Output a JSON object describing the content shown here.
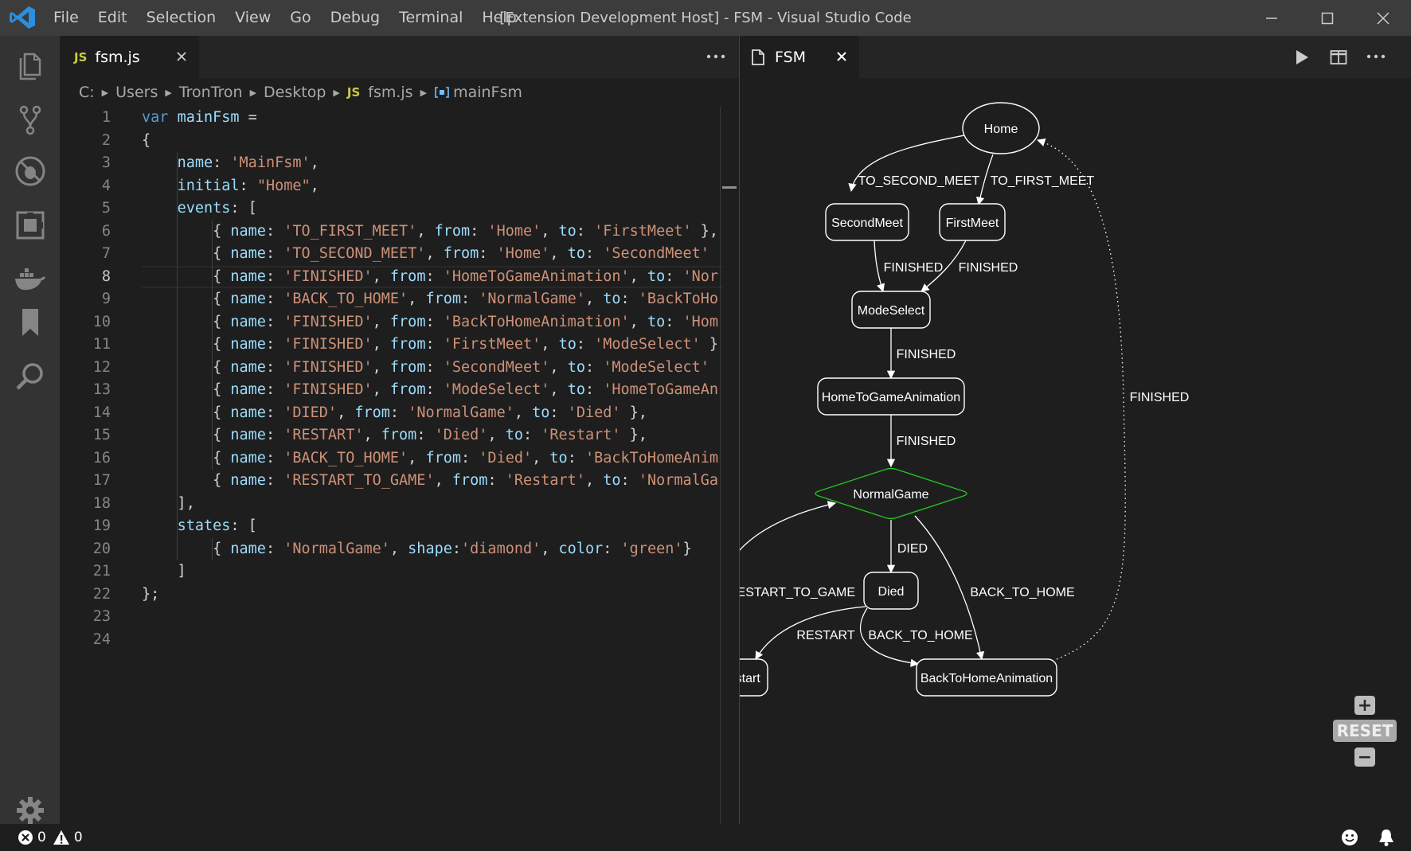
{
  "titlebar": {
    "menu": [
      "File",
      "Edit",
      "Selection",
      "View",
      "Go",
      "Debug",
      "Terminal",
      "Help"
    ],
    "title": "[Extension Development Host] - FSM - Visual Studio Code"
  },
  "activitybar": {
    "icons": [
      "explorer-icon",
      "source-control-icon",
      "debug-icon",
      "extensions-icon",
      "docker-icon",
      "bookmark-icon",
      "search-icon"
    ],
    "bottom_icon": "gear-icon"
  },
  "editor_left": {
    "tab": {
      "badge": "JS",
      "label": "fsm.js"
    },
    "breadcrumb": [
      "C:",
      "Users",
      "TronTron",
      "Desktop",
      "fsm.js",
      "mainFsm"
    ],
    "active_line": 8,
    "lines": [
      [
        [
          "kw",
          "var "
        ],
        [
          "var",
          "mainFsm "
        ],
        [
          "pun",
          "="
        ]
      ],
      [
        [
          "pun",
          "{"
        ]
      ],
      [
        [
          "pun",
          "    "
        ],
        [
          "var",
          "name"
        ],
        [
          "pun",
          ": "
        ],
        [
          "str",
          "'MainFsm'"
        ],
        [
          "pun",
          ","
        ]
      ],
      [
        [
          "pun",
          "    "
        ],
        [
          "var",
          "initial"
        ],
        [
          "pun",
          ": "
        ],
        [
          "str",
          "\"Home\""
        ],
        [
          "pun",
          ","
        ]
      ],
      [
        [
          "pun",
          "    "
        ],
        [
          "var",
          "events"
        ],
        [
          "pun",
          ": ["
        ]
      ],
      [
        [
          "pun",
          "        { "
        ],
        [
          "var",
          "name"
        ],
        [
          "pun",
          ": "
        ],
        [
          "str",
          "'TO_FIRST_MEET'"
        ],
        [
          "pun",
          ", "
        ],
        [
          "var",
          "from"
        ],
        [
          "pun",
          ": "
        ],
        [
          "str",
          "'Home'"
        ],
        [
          "pun",
          ", "
        ],
        [
          "var",
          "to"
        ],
        [
          "pun",
          ": "
        ],
        [
          "str",
          "'FirstMeet'"
        ],
        [
          "pun",
          " },"
        ]
      ],
      [
        [
          "pun",
          "        { "
        ],
        [
          "var",
          "name"
        ],
        [
          "pun",
          ": "
        ],
        [
          "str",
          "'TO_SECOND_MEET'"
        ],
        [
          "pun",
          ", "
        ],
        [
          "var",
          "from"
        ],
        [
          "pun",
          ": "
        ],
        [
          "str",
          "'Home'"
        ],
        [
          "pun",
          ", "
        ],
        [
          "var",
          "to"
        ],
        [
          "pun",
          ": "
        ],
        [
          "str",
          "'SecondMeet'"
        ]
      ],
      [
        [
          "pun",
          "        { "
        ],
        [
          "var",
          "name"
        ],
        [
          "pun",
          ": "
        ],
        [
          "str",
          "'FINISHED'"
        ],
        [
          "pun",
          ", "
        ],
        [
          "var",
          "from"
        ],
        [
          "pun",
          ": "
        ],
        [
          "str",
          "'HomeToGameAnimation'"
        ],
        [
          "pun",
          ", "
        ],
        [
          "var",
          "to"
        ],
        [
          "pun",
          ": "
        ],
        [
          "str",
          "'Nor"
        ]
      ],
      [
        [
          "pun",
          "        { "
        ],
        [
          "var",
          "name"
        ],
        [
          "pun",
          ": "
        ],
        [
          "str",
          "'BACK_TO_HOME'"
        ],
        [
          "pun",
          ", "
        ],
        [
          "var",
          "from"
        ],
        [
          "pun",
          ": "
        ],
        [
          "str",
          "'NormalGame'"
        ],
        [
          "pun",
          ", "
        ],
        [
          "var",
          "to"
        ],
        [
          "pun",
          ": "
        ],
        [
          "str",
          "'BackToHo"
        ]
      ],
      [
        [
          "pun",
          "        { "
        ],
        [
          "var",
          "name"
        ],
        [
          "pun",
          ": "
        ],
        [
          "str",
          "'FINISHED'"
        ],
        [
          "pun",
          ", "
        ],
        [
          "var",
          "from"
        ],
        [
          "pun",
          ": "
        ],
        [
          "str",
          "'BackToHomeAnimation'"
        ],
        [
          "pun",
          ", "
        ],
        [
          "var",
          "to"
        ],
        [
          "pun",
          ": "
        ],
        [
          "str",
          "'Hom"
        ]
      ],
      [
        [
          "pun",
          "        { "
        ],
        [
          "var",
          "name"
        ],
        [
          "pun",
          ": "
        ],
        [
          "str",
          "'FINISHED'"
        ],
        [
          "pun",
          ", "
        ],
        [
          "var",
          "from"
        ],
        [
          "pun",
          ": "
        ],
        [
          "str",
          "'FirstMeet'"
        ],
        [
          "pun",
          ", "
        ],
        [
          "var",
          "to"
        ],
        [
          "pun",
          ": "
        ],
        [
          "str",
          "'ModeSelect'"
        ],
        [
          "pun",
          " }"
        ]
      ],
      [
        [
          "pun",
          "        { "
        ],
        [
          "var",
          "name"
        ],
        [
          "pun",
          ": "
        ],
        [
          "str",
          "'FINISHED'"
        ],
        [
          "pun",
          ", "
        ],
        [
          "var",
          "from"
        ],
        [
          "pun",
          ": "
        ],
        [
          "str",
          "'SecondMeet'"
        ],
        [
          "pun",
          ", "
        ],
        [
          "var",
          "to"
        ],
        [
          "pun",
          ": "
        ],
        [
          "str",
          "'ModeSelect'"
        ]
      ],
      [
        [
          "pun",
          "        { "
        ],
        [
          "var",
          "name"
        ],
        [
          "pun",
          ": "
        ],
        [
          "str",
          "'FINISHED'"
        ],
        [
          "pun",
          ", "
        ],
        [
          "var",
          "from"
        ],
        [
          "pun",
          ": "
        ],
        [
          "str",
          "'ModeSelect'"
        ],
        [
          "pun",
          ", "
        ],
        [
          "var",
          "to"
        ],
        [
          "pun",
          ": "
        ],
        [
          "str",
          "'HomeToGameAn"
        ]
      ],
      [
        [
          "pun",
          "        { "
        ],
        [
          "var",
          "name"
        ],
        [
          "pun",
          ": "
        ],
        [
          "str",
          "'DIED'"
        ],
        [
          "pun",
          ", "
        ],
        [
          "var",
          "from"
        ],
        [
          "pun",
          ": "
        ],
        [
          "str",
          "'NormalGame'"
        ],
        [
          "pun",
          ", "
        ],
        [
          "var",
          "to"
        ],
        [
          "pun",
          ": "
        ],
        [
          "str",
          "'Died'"
        ],
        [
          "pun",
          " },"
        ]
      ],
      [
        [
          "pun",
          "        { "
        ],
        [
          "var",
          "name"
        ],
        [
          "pun",
          ": "
        ],
        [
          "str",
          "'RESTART'"
        ],
        [
          "pun",
          ", "
        ],
        [
          "var",
          "from"
        ],
        [
          "pun",
          ": "
        ],
        [
          "str",
          "'Died'"
        ],
        [
          "pun",
          ", "
        ],
        [
          "var",
          "to"
        ],
        [
          "pun",
          ": "
        ],
        [
          "str",
          "'Restart'"
        ],
        [
          "pun",
          " },"
        ]
      ],
      [
        [
          "pun",
          "        { "
        ],
        [
          "var",
          "name"
        ],
        [
          "pun",
          ": "
        ],
        [
          "str",
          "'BACK_TO_HOME'"
        ],
        [
          "pun",
          ", "
        ],
        [
          "var",
          "from"
        ],
        [
          "pun",
          ": "
        ],
        [
          "str",
          "'Died'"
        ],
        [
          "pun",
          ", "
        ],
        [
          "var",
          "to"
        ],
        [
          "pun",
          ": "
        ],
        [
          "str",
          "'BackToHomeAnim"
        ]
      ],
      [
        [
          "pun",
          "        { "
        ],
        [
          "var",
          "name"
        ],
        [
          "pun",
          ": "
        ],
        [
          "str",
          "'RESTART_TO_GAME'"
        ],
        [
          "pun",
          ", "
        ],
        [
          "var",
          "from"
        ],
        [
          "pun",
          ": "
        ],
        [
          "str",
          "'Restart'"
        ],
        [
          "pun",
          ", "
        ],
        [
          "var",
          "to"
        ],
        [
          "pun",
          ": "
        ],
        [
          "str",
          "'NormalGa"
        ]
      ],
      [
        [
          "pun",
          "    ],"
        ]
      ],
      [
        [
          "pun",
          "    "
        ],
        [
          "var",
          "states"
        ],
        [
          "pun",
          ": ["
        ]
      ],
      [
        [
          "pun",
          "        { "
        ],
        [
          "var",
          "name"
        ],
        [
          "pun",
          ": "
        ],
        [
          "str",
          "'NormalGame'"
        ],
        [
          "pun",
          ", "
        ],
        [
          "var",
          "shape"
        ],
        [
          "pun",
          ":"
        ],
        [
          "str",
          "'diamond'"
        ],
        [
          "pun",
          ", "
        ],
        [
          "var",
          "color"
        ],
        [
          "pun",
          ": "
        ],
        [
          "str",
          "'green'"
        ],
        [
          "pun",
          "}"
        ]
      ],
      [
        [
          "pun",
          "    ]"
        ]
      ],
      [
        [
          "pun",
          "};"
        ]
      ],
      [],
      []
    ]
  },
  "editor_right": {
    "tab": {
      "label": "FSM"
    },
    "graph": {
      "nodes": [
        {
          "id": "Home",
          "label": "Home",
          "shape": "ellipse"
        },
        {
          "id": "SecondMeet",
          "label": "SecondMeet",
          "shape": "box"
        },
        {
          "id": "FirstMeet",
          "label": "FirstMeet",
          "shape": "box"
        },
        {
          "id": "ModeSelect",
          "label": "ModeSelect",
          "shape": "box"
        },
        {
          "id": "HomeToGameAnimation",
          "label": "HomeToGameAnimation",
          "shape": "box"
        },
        {
          "id": "NormalGame",
          "label": "NormalGame",
          "shape": "diamond",
          "color": "#22c222"
        },
        {
          "id": "Died",
          "label": "Died",
          "shape": "box"
        },
        {
          "id": "Restart",
          "label": "Restart",
          "shape": "box"
        },
        {
          "id": "BackToHomeAnimation",
          "label": "BackToHomeAnimation",
          "shape": "box"
        }
      ],
      "edges": [
        {
          "from": "Home",
          "to": "SecondMeet",
          "label": "TO_SECOND_MEET"
        },
        {
          "from": "Home",
          "to": "FirstMeet",
          "label": "TO_FIRST_MEET"
        },
        {
          "from": "SecondMeet",
          "to": "ModeSelect",
          "label": "FINISHED"
        },
        {
          "from": "FirstMeet",
          "to": "ModeSelect",
          "label": "FINISHED"
        },
        {
          "from": "ModeSelect",
          "to": "HomeToGameAnimation",
          "label": "FINISHED"
        },
        {
          "from": "HomeToGameAnimation",
          "to": "NormalGame",
          "label": "FINISHED"
        },
        {
          "from": "NormalGame",
          "to": "Died",
          "label": "DIED"
        },
        {
          "from": "NormalGame",
          "to": "BackToHomeAnimation",
          "label": "BACK_TO_HOME"
        },
        {
          "from": "Restart",
          "to": "NormalGame",
          "label": "RESTART_TO_GAME"
        },
        {
          "from": "Died",
          "to": "Restart",
          "label": "RESTART"
        },
        {
          "from": "Died",
          "to": "BackToHomeAnimation",
          "label": "BACK_TO_HOME"
        },
        {
          "from": "BackToHomeAnimation",
          "to": "Home",
          "label": "FINISHED",
          "style": "dotted"
        }
      ]
    },
    "zoom": {
      "plus": "+",
      "reset": "RESET",
      "minus": "−"
    }
  },
  "statusbar": {
    "errors": "0",
    "warnings": "0"
  }
}
